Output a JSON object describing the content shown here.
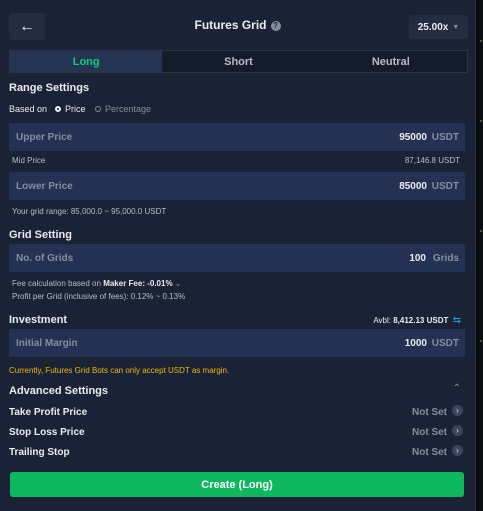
{
  "header": {
    "back_icon": "arrow-left-icon",
    "title": "Futures Grid",
    "help_icon": "question-circle-icon",
    "leverage": "25.00x"
  },
  "tabs": [
    {
      "label": "Long",
      "active": true
    },
    {
      "label": "Short",
      "active": false
    },
    {
      "label": "Neutral",
      "active": false
    }
  ],
  "range_settings": {
    "title": "Range Settings",
    "based_on_label": "Based on",
    "options": [
      {
        "label": "Price",
        "selected": true
      },
      {
        "label": "Percentage",
        "selected": false
      }
    ],
    "upper_price": {
      "label": "Upper Price",
      "value": "95000",
      "unit": "USDT"
    },
    "mid_price": {
      "label": "Mid Price",
      "value": "87,146.8 USDT"
    },
    "lower_price": {
      "label": "Lower Price",
      "value": "85000",
      "unit": "USDT"
    },
    "range_text": "Your grid range: 85,000.0 ~ 95,000.0 USDT"
  },
  "grid_setting": {
    "title": "Grid Setting",
    "num_grids": {
      "label": "No. of Grids",
      "value": "100",
      "unit": "Grids"
    },
    "fee_prefix": "Fee calculation based on",
    "fee_value": "Maker Fee: -0.01%",
    "profit_text": "Profit per Grid (inclusive of fees): 0.12% ~ 0.13%"
  },
  "investment": {
    "title": "Investment",
    "avbl_label": "Avbl:",
    "avbl_value": "8,412.13 USDT",
    "swap_icon": "swap-arrows-icon",
    "initial_margin": {
      "label": "Initial Margin",
      "value": "1000",
      "unit": "USDT"
    },
    "warning": "Currently, Futures Grid Bots can only accept USDT as margin."
  },
  "advanced": {
    "title": "Advanced Settings",
    "rows": [
      {
        "label": "Take Profit Price",
        "value": "Not Set"
      },
      {
        "label": "Stop Loss Price",
        "value": "Not Set"
      },
      {
        "label": "Trailing Stop",
        "value": "Not Set"
      }
    ]
  },
  "create_button": "Create (Long)",
  "colors": {
    "background": "#1a2236",
    "input": "#243152",
    "accent_green": "#0ecb81",
    "button_green": "#0fb85f",
    "warning": "#f0b90b",
    "link_blue": "#1e9ce8"
  }
}
